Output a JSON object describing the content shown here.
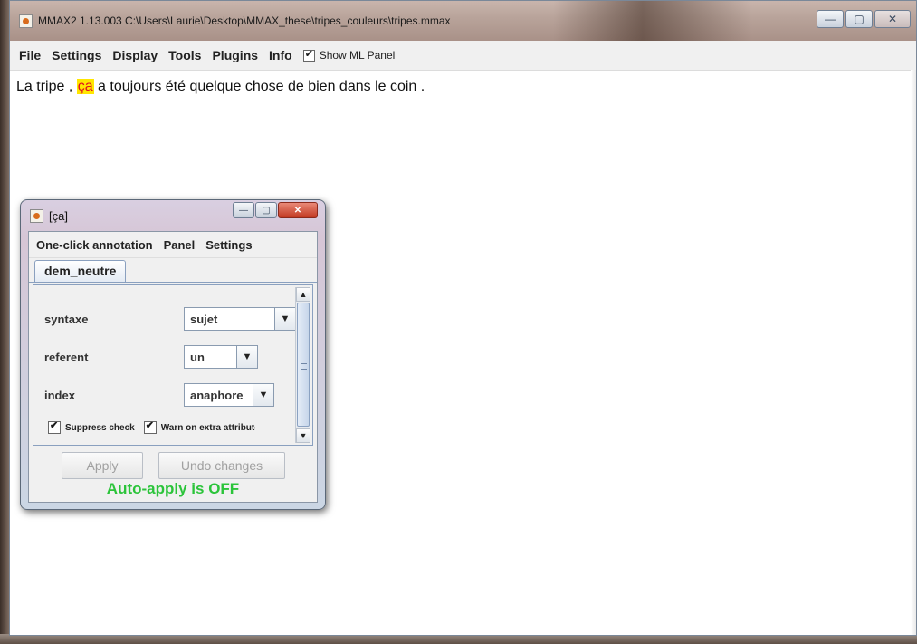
{
  "main_window": {
    "title": "MMAX2 1.13.003 C:\\Users\\Laurie\\Desktop\\MMAX_these\\tripes_couleurs\\tripes.mmax",
    "controls": {
      "minimize": "—",
      "maximize": "▢",
      "close": "✕"
    },
    "menu": [
      "File",
      "Settings",
      "Display",
      "Tools",
      "Plugins",
      "Info"
    ],
    "show_ml_panel": {
      "label": "Show ML Panel",
      "checked": true
    }
  },
  "document": {
    "before": "La tripe , ",
    "highlighted": "ça",
    "after": " a toujours été quelque chose de bien dans le coin ."
  },
  "annotation_window": {
    "title": "[ça]",
    "controls": {
      "minimize": "—",
      "maximize": "▢",
      "close": "✕"
    },
    "menu": [
      "One-click annotation",
      "Panel",
      "Settings"
    ],
    "tab": "dem_neutre",
    "attributes": [
      {
        "label": "syntaxe",
        "value": "sujet"
      },
      {
        "label": "referent",
        "value": "un"
      },
      {
        "label": "index",
        "value": "anaphore"
      }
    ],
    "suppress_check": {
      "label": "Suppress check",
      "checked": true
    },
    "warn_extra": {
      "label": "Warn on extra attributes",
      "checked": true
    },
    "apply_label": "Apply",
    "undo_label": "Undo changes",
    "status": "Auto-apply is OFF"
  },
  "colors": {
    "highlight_bg": "#ffe600",
    "highlight_text": "#e0111e",
    "status_text": "#2bc43a"
  }
}
